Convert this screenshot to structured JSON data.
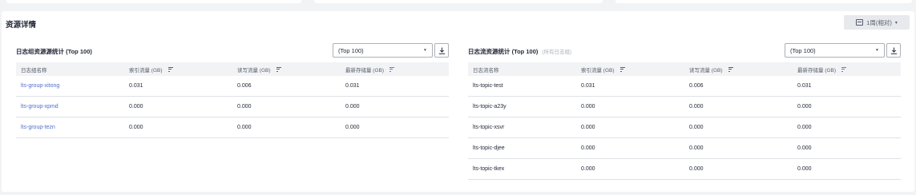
{
  "section": {
    "title": "资源详情",
    "period_label": "1周(相对)",
    "period_caret": "▾"
  },
  "left": {
    "title": "日志组资源源统计 (Top 100)",
    "select_value": "(Top 100)",
    "columns": [
      "日志组名称",
      "索引流量 (GB)",
      "读写流量 (GB)",
      "最新存储量 (GB)"
    ],
    "rows": [
      [
        "lts-group-xitong",
        "0.031",
        "0.006",
        "0.031"
      ],
      [
        "lts-group-xpmd",
        "0.000",
        "0.000",
        "0.000"
      ],
      [
        "lts-group-tezn",
        "0.000",
        "0.000",
        "0.000"
      ]
    ]
  },
  "right": {
    "title": "日志流资源统计 (Top 100)",
    "subtitle": "(所有日志组)",
    "select_value": "(Top 100)",
    "columns": [
      "日志流名称",
      "索引流量 (GB)",
      "读写流量 (GB)",
      "最新存储量 (GB)"
    ],
    "rows": [
      [
        "lts-topic-test",
        "0.031",
        "0.006",
        "0.031"
      ],
      [
        "lts-topic-a23y",
        "0.000",
        "0.000",
        "0.000"
      ],
      [
        "lts-topic-xsvr",
        "0.000",
        "0.000",
        "0.000"
      ],
      [
        "lts-topic-djee",
        "0.000",
        "0.000",
        "0.000"
      ],
      [
        "lts-topic-tkex",
        "0.000",
        "0.000",
        "0.000"
      ]
    ]
  },
  "colors": {
    "link": "#526ecc",
    "sort_active": "#5e7ce0",
    "header_bg": "#f2f3f5"
  },
  "icons": {
    "period": "calendar-icon",
    "select": "chevron-down-icon",
    "download": "download-icon",
    "sort": "sort-icon"
  }
}
